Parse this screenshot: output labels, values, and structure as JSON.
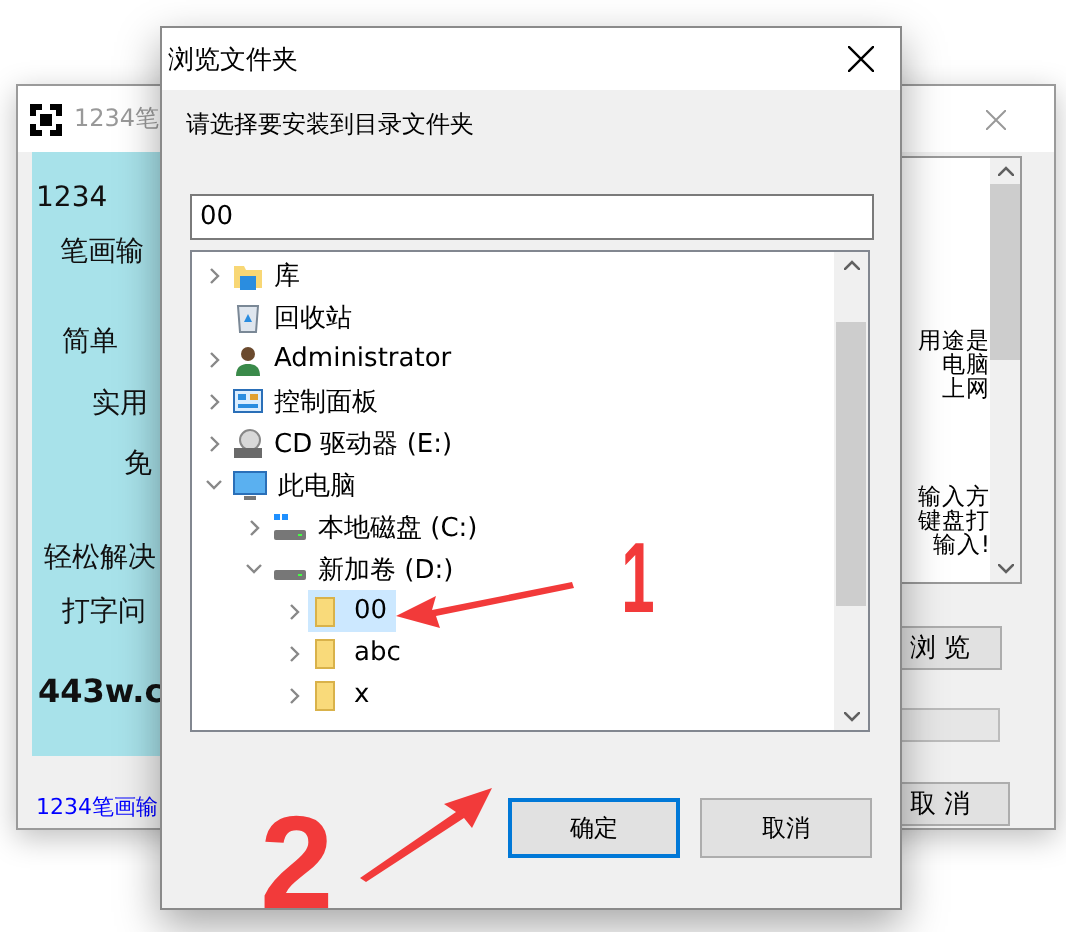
{
  "background_window": {
    "title": "1234笔",
    "progress": {
      "level": 0
    },
    "intro_lines": [
      "1234",
      "笔画输",
      "简单",
      "实用",
      "免",
      "轻松解决",
      "打字问",
      "443w.c"
    ],
    "footer_link": "1234笔画输",
    "description_fragments": [
      "用途是",
      "电脑",
      "上网",
      "输入方",
      "键盘打",
      "输入!"
    ],
    "browse_button": "浏 览",
    "cancel_button": "取 消"
  },
  "dialog": {
    "title": "浏览文件夹",
    "prompt": "请选择要安装到目录文件夹",
    "folder_field": "00",
    "tree": [
      {
        "label": "库",
        "kind": "library",
        "expanded": false,
        "selected": false
      },
      {
        "label": "回收站",
        "kind": "recycle-bin",
        "selected": false
      },
      {
        "label": "Administrator",
        "kind": "user",
        "expanded": false,
        "selected": false
      },
      {
        "label": "控制面板",
        "kind": "control-panel",
        "expanded": false,
        "selected": false
      },
      {
        "label": "CD 驱动器 (E:)",
        "kind": "cd-drive",
        "expanded": false,
        "selected": false
      },
      {
        "label": "此电脑",
        "kind": "computer",
        "expanded": true,
        "selected": false,
        "children": [
          {
            "label": "本地磁盘 (C:)",
            "kind": "system-drive",
            "expanded": false,
            "selected": false
          },
          {
            "label": "新加卷 (D:)",
            "kind": "drive",
            "expanded": true,
            "selected": false,
            "children": [
              {
                "label": "00",
                "kind": "folder",
                "expanded": false,
                "selected": true
              },
              {
                "label": "abc",
                "kind": "folder",
                "expanded": false,
                "selected": false
              },
              {
                "label": "x",
                "kind": "folder",
                "expanded": false,
                "selected": false
              }
            ]
          }
        ]
      }
    ],
    "ok_button": "确定",
    "cancel_button": "取消"
  },
  "annotations": [
    {
      "label": "1"
    },
    {
      "label": "2"
    }
  ]
}
